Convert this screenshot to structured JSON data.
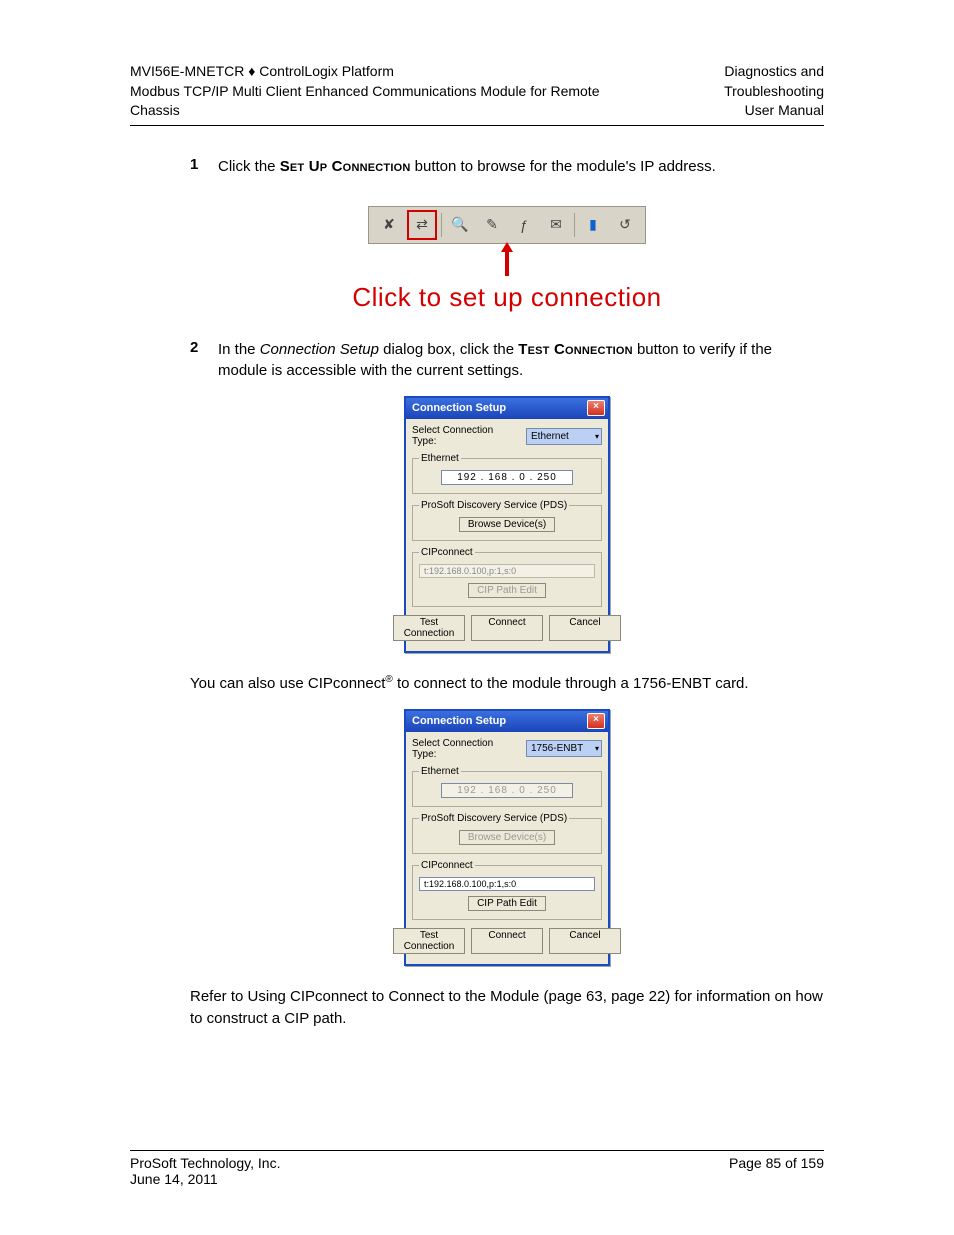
{
  "header": {
    "left_line1_a": "MVI56E-MNETCR ",
    "left_line1_b": " ControlLogix Platform",
    "left_line2": "Modbus TCP/IP Multi Client Enhanced Communications Module for Remote Chassis",
    "right_line1": "Diagnostics and Troubleshooting",
    "right_line2": "User Manual"
  },
  "steps": {
    "s1_num": "1",
    "s1_pre": "Click the ",
    "s1_btn": "Set Up Connection",
    "s1_post": " button to browse for the module's IP address.",
    "toolbar_caption": "Click to set up connection",
    "s2_num": "2",
    "s2_pre": "In the ",
    "s2_dialog_name": "Connection Setup",
    "s2_mid": " dialog box, click the ",
    "s2_btn": "Test Connection",
    "s2_post": " button to verify if the module is accessible with the current settings."
  },
  "toolbar_icons": [
    "✘",
    "⇄",
    "🔍",
    "✎",
    "ƒ",
    "✉",
    "▮",
    "↺"
  ],
  "dialog1": {
    "title": "Connection Setup",
    "select_label": "Select Connection Type:",
    "select_value": "Ethernet",
    "eth_legend": "Ethernet",
    "ip": "192 . 168 .   0   . 250",
    "pds_legend": "ProSoft Discovery Service (PDS)",
    "pds_btn": "Browse Device(s)",
    "cip_legend": "CIPconnect",
    "cip_path": "t:192.168.0.100,p:1,s:0",
    "cip_btn": "CIP Path Edit",
    "btn_test": "Test Connection",
    "btn_connect": "Connect",
    "btn_cancel": "Cancel"
  },
  "para1_a": "You can also use CIPconnect",
  "para1_sup": "®",
  "para1_b": " to connect to the module through a 1756-ENBT card.",
  "dialog2": {
    "title": "Connection Setup",
    "select_label": "Select Connection Type:",
    "select_value": "1756-ENBT",
    "eth_legend": "Ethernet",
    "ip": "192 . 168 .   0   . 250",
    "pds_legend": "ProSoft Discovery Service (PDS)",
    "pds_btn": "Browse Device(s)",
    "cip_legend": "CIPconnect",
    "cip_path": "t:192.168.0.100,p:1,s:0",
    "cip_btn": "CIP Path Edit",
    "btn_test": "Test Connection",
    "btn_connect": "Connect",
    "btn_cancel": "Cancel"
  },
  "para2": "Refer to Using CIPconnect to Connect to the Module (page 63, page 22) for information on how to construct a CIP path.",
  "footer": {
    "left1": "ProSoft Technology, Inc.",
    "left2": "June 14, 2011",
    "right": "Page 85 of 159"
  }
}
